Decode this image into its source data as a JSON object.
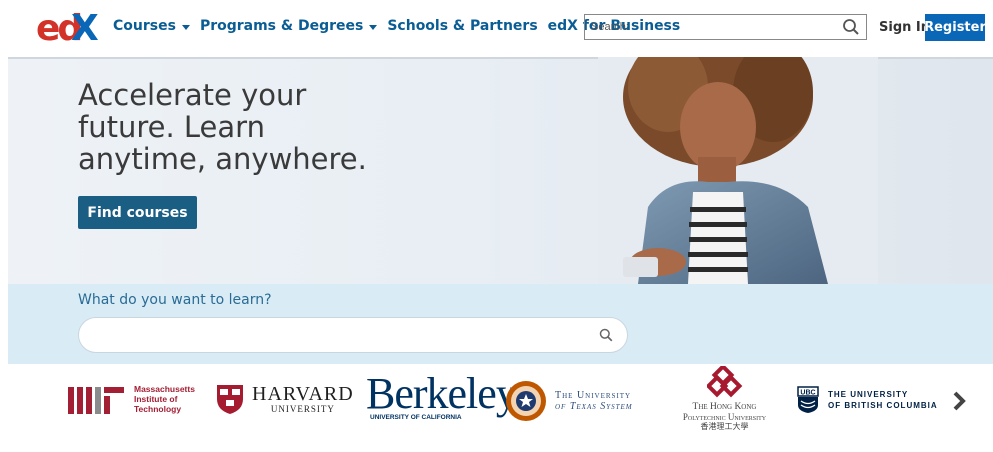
{
  "header": {
    "logo_text": "edX",
    "nav": [
      {
        "label": "Courses",
        "has_dropdown": true
      },
      {
        "label": "Programs & Degrees",
        "has_dropdown": true
      },
      {
        "label": "Schools & Partners",
        "has_dropdown": false
      },
      {
        "label": "edX for Business",
        "has_dropdown": false
      }
    ],
    "search_placeholder": "Search:",
    "signin_label": "Sign In",
    "register_label": "Register"
  },
  "hero": {
    "title": "Accelerate your future. Learn anytime, anywhere.",
    "cta_label": "Find courses"
  },
  "learn": {
    "label": "What do you want to learn?",
    "placeholder": ""
  },
  "partners": {
    "mit": {
      "line1": "Massachusetts",
      "line2": "Institute of",
      "line3": "Technology"
    },
    "harvard": {
      "name": "HARVARD",
      "sub": "UNIVERSITY"
    },
    "berkeley": {
      "name": "Berkeley",
      "sub": "UNIVERSITY OF CALIFORNIA"
    },
    "texas": {
      "line1": "The University",
      "line2": "of Texas System"
    },
    "hongkong": {
      "line1": "The Hong Kong",
      "line2": "Polytechnic University",
      "line3": "香港理工大學"
    },
    "ubc": {
      "badge": "UBC",
      "line1": "THE UNIVERSITY",
      "line2": "OF BRITISH COLUMBIA"
    }
  },
  "colors": {
    "brand_blue": "#0a5d94",
    "register_bg": "#0a66b6",
    "cta_bg": "#1b5e84",
    "learn_bg": "#d9ecf6",
    "mit_red": "#a31f34",
    "harvard_red": "#a51c30",
    "berkeley_blue": "#003262"
  },
  "icons": {
    "search": "search-icon",
    "next": "chevron-right-icon"
  }
}
